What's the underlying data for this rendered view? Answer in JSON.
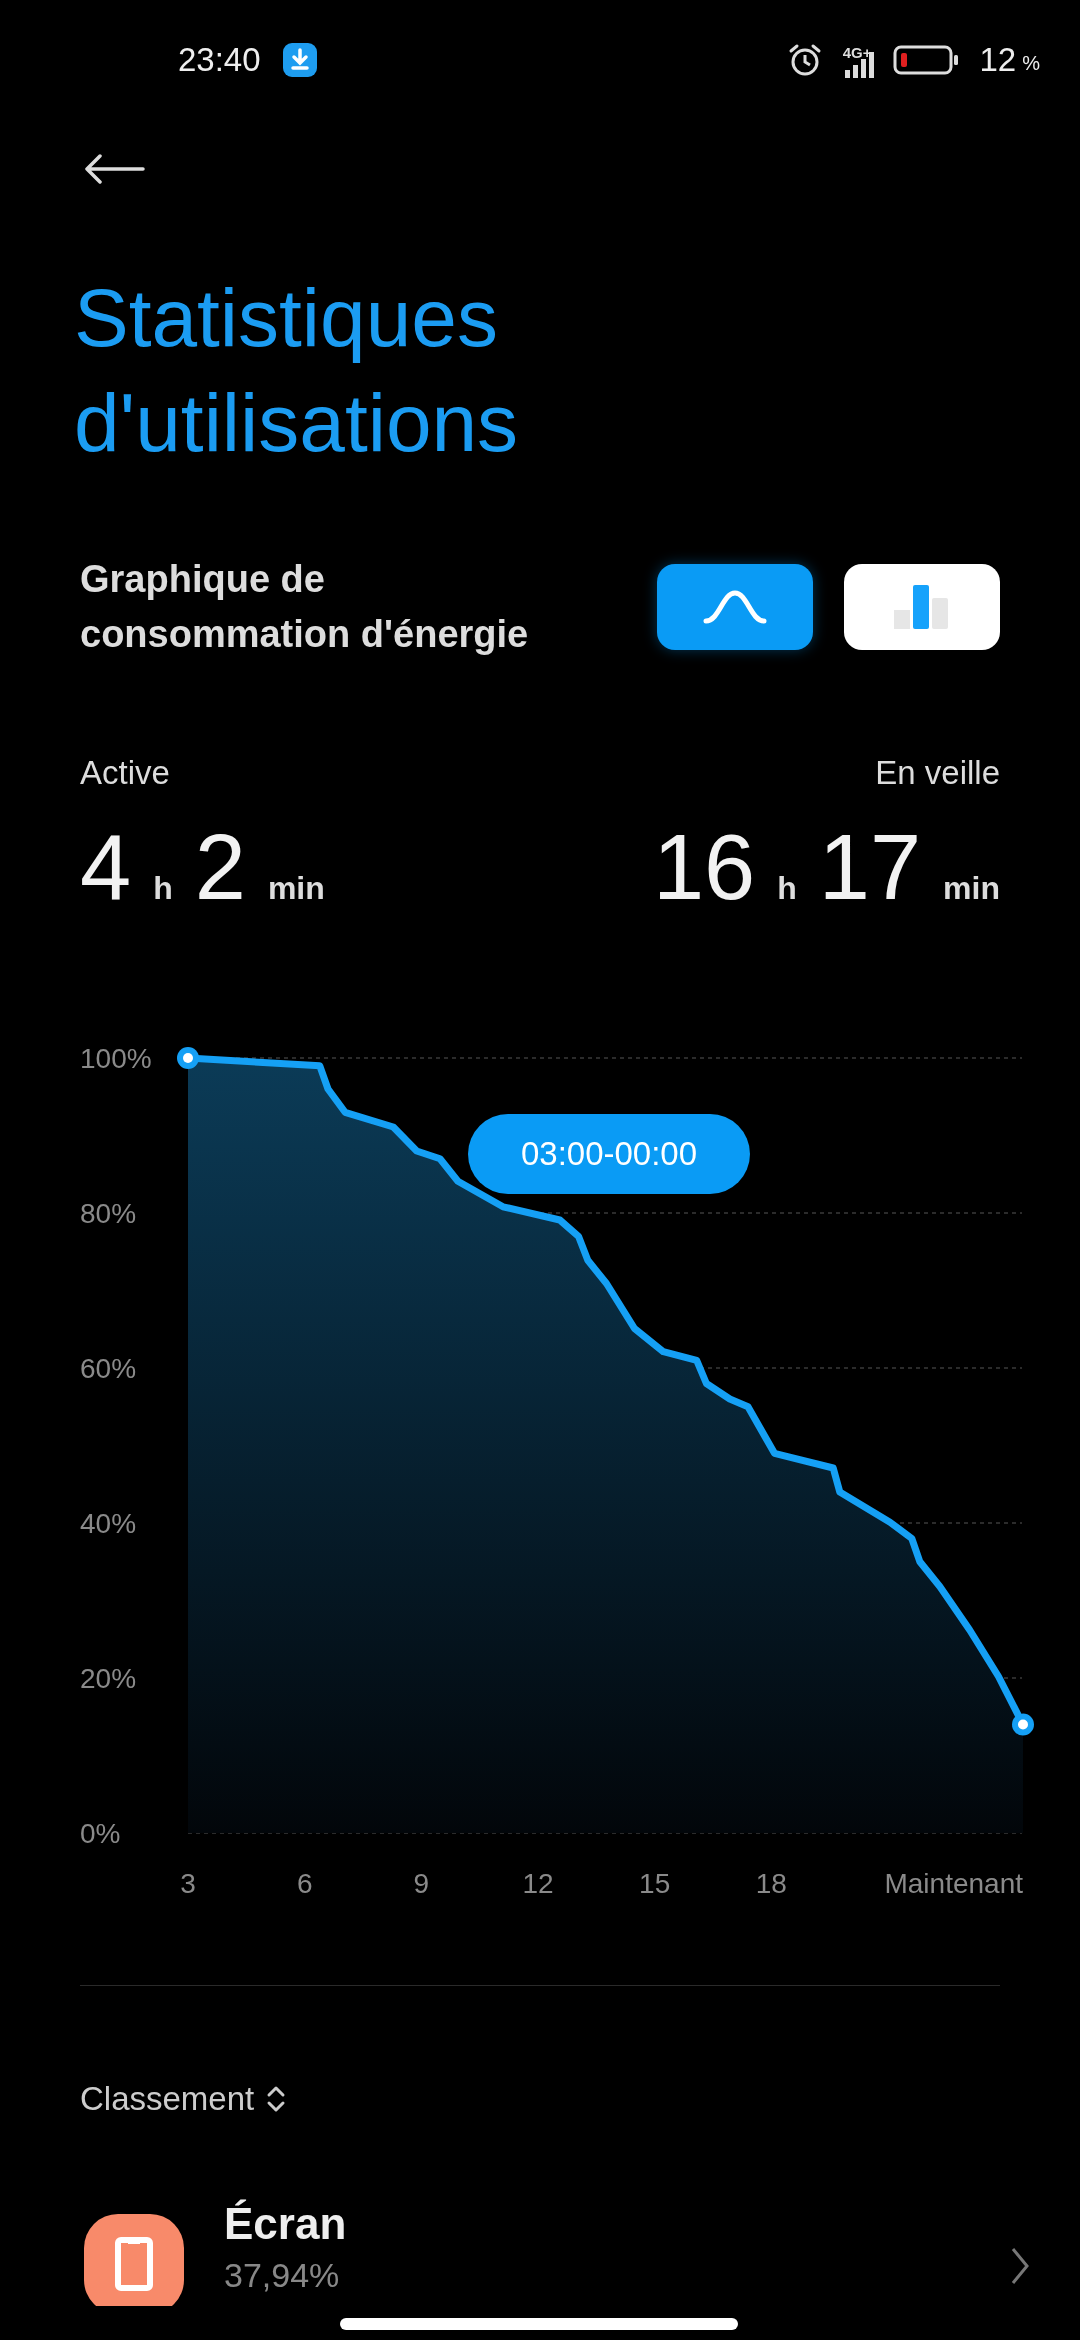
{
  "status_bar": {
    "time": "23:40",
    "network": "4G+",
    "battery_percent": "12",
    "battery_unit": "%"
  },
  "title": "Statistiques d'utilisations",
  "section": {
    "title": "Graphique de consommation d'énergie"
  },
  "view_toggle": [
    {
      "kind": "curve",
      "selected": true
    },
    {
      "kind": "bars",
      "selected": false
    }
  ],
  "stats": [
    {
      "label": "Active",
      "hours": "4",
      "hours_unit": "h",
      "minutes": "2",
      "minutes_unit": "min"
    },
    {
      "label": "En veille",
      "hours": "16",
      "hours_unit": "h",
      "minutes": "17",
      "minutes_unit": "min"
    }
  ],
  "chart": {
    "tooltip": "03:00-00:00",
    "chart_data": {
      "type": "area",
      "grid": true,
      "xlim": [
        3,
        24.47
      ],
      "ylim": [
        0,
        100
      ],
      "x": [
        3,
        6.39,
        6.6,
        7.04,
        8.28,
        8.88,
        9.48,
        9.94,
        11.1,
        12.56,
        13.04,
        13.28,
        13.76,
        14.48,
        15.22,
        16.08,
        16.33,
        16.93,
        17.4,
        18.08,
        19.59,
        19.76,
        21.05,
        21.61,
        21.82,
        22.33,
        23.1,
        23.84,
        24.47
      ],
      "series": [
        {
          "color": "#15a0f5",
          "values": [
            100,
            99,
            96,
            93,
            91.1,
            88,
            87,
            84.1,
            80.8,
            79.1,
            77,
            73.9,
            70.9,
            65.1,
            62.1,
            61,
            58,
            56,
            55,
            49,
            47.1,
            44,
            40.1,
            38,
            35,
            31.8,
            26.2,
            20.2,
            14
          ]
        }
      ],
      "xticks": [
        {
          "value": 3,
          "label": "3"
        },
        {
          "value": 6,
          "label": "6"
        },
        {
          "value": 9,
          "label": "9"
        },
        {
          "value": 12,
          "label": "12"
        },
        {
          "value": 15,
          "label": "15"
        },
        {
          "value": 18,
          "label": "18"
        },
        {
          "value": 24.47,
          "label": "Maintenant"
        }
      ],
      "yticks": [
        {
          "value": 0,
          "label": "0%"
        },
        {
          "value": 20,
          "label": "20%"
        },
        {
          "value": 40,
          "label": "40%"
        },
        {
          "value": 60,
          "label": "60%"
        },
        {
          "value": 80,
          "label": "80%"
        },
        {
          "value": 100,
          "label": "100%"
        }
      ]
    }
  },
  "ranking": {
    "label": "Classement",
    "items": [
      {
        "name": "Écran",
        "percent": "37,94%",
        "color": "#f88a6a"
      }
    ]
  }
}
